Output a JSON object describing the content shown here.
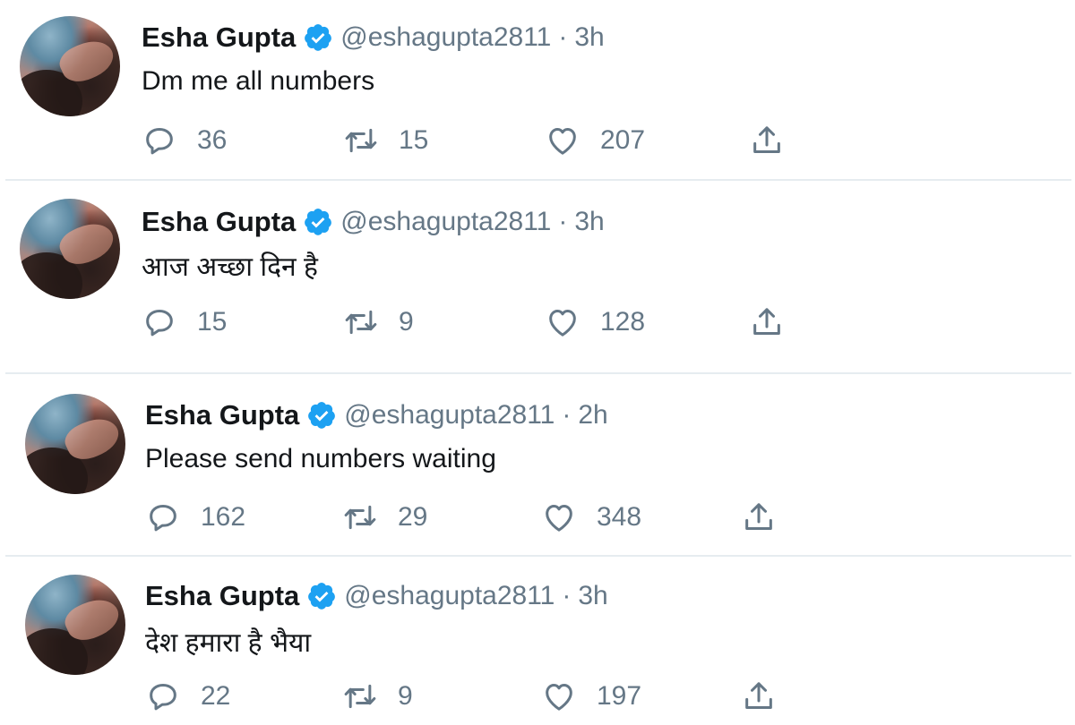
{
  "colors": {
    "verified_blue": "#1da1f2",
    "muted": "#657786",
    "text": "#14171a"
  },
  "tweets": [
    {
      "name": "Esha Gupta",
      "handle": "@eshagupta2811",
      "separator": "·",
      "time": "3h",
      "text": "Dm me all numbers",
      "replies": "36",
      "retweets": "15",
      "likes": "207"
    },
    {
      "name": "Esha Gupta",
      "handle": "@eshagupta2811",
      "separator": "·",
      "time": "3h",
      "text": "आज अच्छा दिन है",
      "replies": "15",
      "retweets": "9",
      "likes": "128"
    },
    {
      "name": "Esha Gupta",
      "handle": "@eshagupta2811",
      "separator": "·",
      "time": "2h",
      "text": "Please send numbers waiting",
      "replies": "162",
      "retweets": "29",
      "likes": "348"
    },
    {
      "name": "Esha Gupta",
      "handle": "@eshagupta2811",
      "separator": "·",
      "time": "3h",
      "text": "देश हमारा है भैया",
      "replies": "22",
      "retweets": "9",
      "likes": "197"
    }
  ]
}
